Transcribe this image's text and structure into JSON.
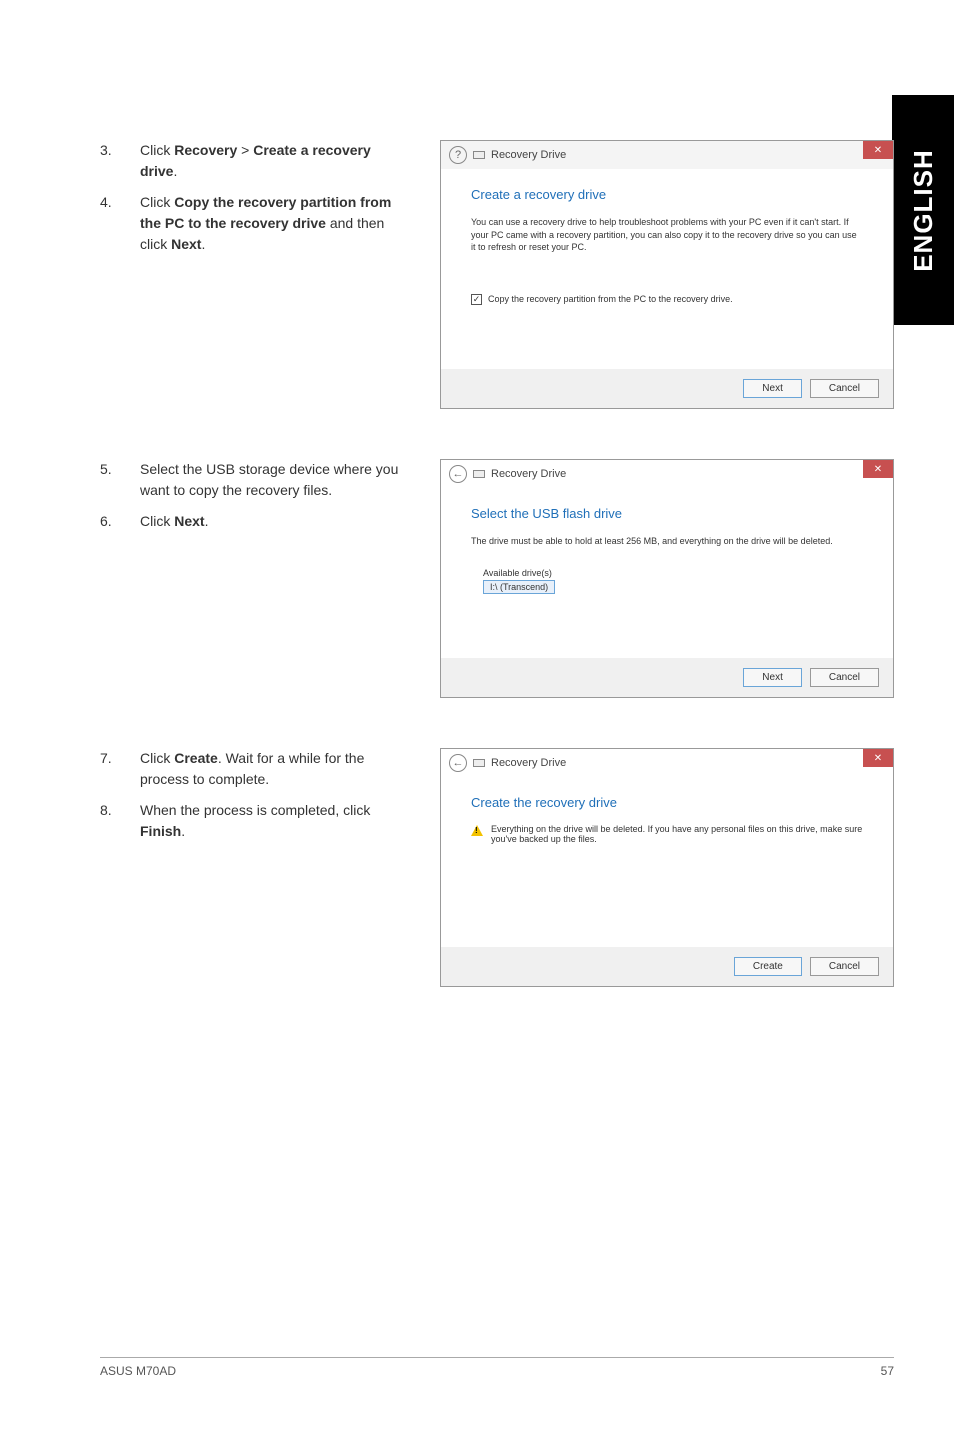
{
  "sideTab": "ENGLISH",
  "block1": {
    "steps": [
      {
        "num": "3.",
        "pre": "Click ",
        "b1": "Recovery",
        "mid": " > ",
        "b2": "Create a recovery drive",
        "post": "."
      },
      {
        "num": "4.",
        "pre": "Click ",
        "b1": "Copy the recovery partition from the PC to the recovery drive",
        "mid": " and then click ",
        "b2": "Next",
        "post": "."
      }
    ],
    "dialog": {
      "title": "Recovery Drive",
      "heading": "Create a recovery drive",
      "body": "You can use a recovery drive to help troubleshoot problems with your PC even if it can't start. If your PC came with a recovery partition, you can also copy it to the recovery drive so you can use it to refresh or reset your PC.",
      "checkboxLabel": "Copy the recovery partition from the PC to the recovery drive.",
      "nextBtn": "Next",
      "cancelBtn": "Cancel",
      "closeGlyph": "✕"
    }
  },
  "block2": {
    "steps": [
      {
        "num": "5.",
        "text": "Select the USB storage device where you want to copy the recovery files."
      },
      {
        "num": "6.",
        "pre": "Click ",
        "b1": "Next",
        "post": "."
      }
    ],
    "dialog": {
      "title": "Recovery Drive",
      "heading": "Select the USB flash drive",
      "body": "The drive must be able to hold at least 256 MB, and everything on the drive will be deleted.",
      "availLabel": "Available drive(s)",
      "driveItem": "I:\\ (Transcend)",
      "nextBtn": "Next",
      "cancelBtn": "Cancel",
      "backGlyph": "←",
      "closeGlyph": "✕"
    }
  },
  "block3": {
    "steps": [
      {
        "num": "7.",
        "pre": "Click ",
        "b1": "Create",
        "post": ". Wait for a while for the process to complete."
      },
      {
        "num": "8.",
        "pre": "When the process is completed, click ",
        "b1": "Finish",
        "post": "."
      }
    ],
    "dialog": {
      "title": "Recovery Drive",
      "heading": "Create the recovery drive",
      "warn": "Everything on the drive will be deleted. If you have any personal files on this drive, make sure you've backed up the files.",
      "createBtn": "Create",
      "cancelBtn": "Cancel",
      "backGlyph": "←",
      "closeGlyph": "✕"
    }
  },
  "footer": {
    "left": "ASUS M70AD",
    "right": "57"
  }
}
